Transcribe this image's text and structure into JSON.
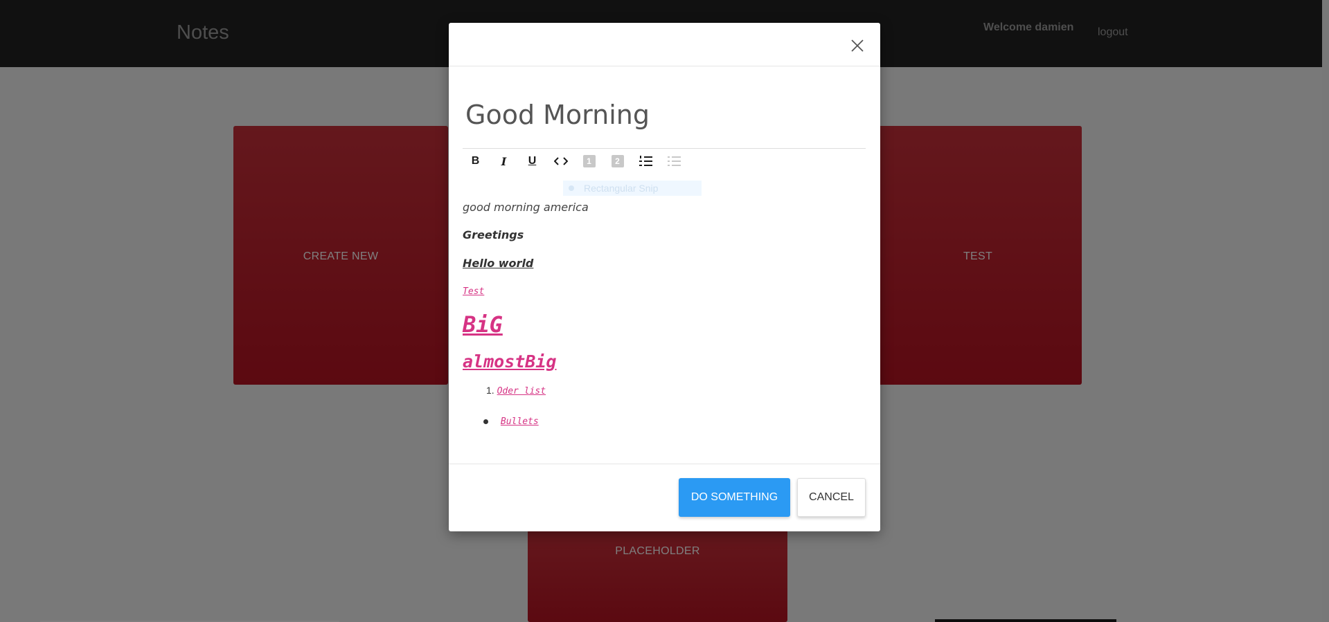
{
  "app": {
    "brand": "Notes",
    "welcome": "Welcome damien",
    "logout": "logout"
  },
  "cards": {
    "create_new": "CREATE NEW",
    "test": "TEST",
    "placeholder": "PLACEHOLDER"
  },
  "colors": {
    "card_red": "#c9303a",
    "primary_blue": "#2b9af3",
    "code_pink": "#d63384"
  },
  "modal": {
    "title": "Good Morning",
    "toolbar": [
      {
        "name": "bold",
        "icon": "bold-icon",
        "label": "B"
      },
      {
        "name": "italic",
        "icon": "italic-icon",
        "label": "I"
      },
      {
        "name": "underline",
        "icon": "underline-icon",
        "label": "U"
      },
      {
        "name": "code",
        "icon": "code-icon"
      },
      {
        "name": "heading-1",
        "icon": "heading-one-icon",
        "label": "1"
      },
      {
        "name": "heading-2",
        "icon": "heading-two-icon",
        "label": "2"
      },
      {
        "name": "ordered-list",
        "icon": "ordered-list-icon"
      },
      {
        "name": "bulleted-list",
        "icon": "bulleted-list-icon"
      }
    ],
    "overlay_ghost": "Rectangular Snip",
    "content": {
      "line1": "good morning america",
      "line2": "Greetings",
      "line3": "Hello world",
      "line4": "Test",
      "line5": "BiG",
      "line6": "almostBig",
      "ordered_number": "1.",
      "ordered_item": "Oder list",
      "bullet_item": "Bullets "
    },
    "buttons": {
      "primary": "DO SOMETHING",
      "cancel": "CANCEL"
    }
  }
}
